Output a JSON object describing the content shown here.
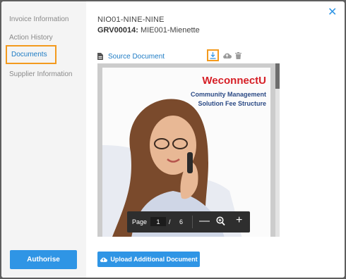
{
  "sidebar": {
    "items": [
      {
        "label": "Invoice Information"
      },
      {
        "label": "Action History"
      },
      {
        "label": "Documents"
      },
      {
        "label": "Supplier Information"
      }
    ],
    "authorise_label": "Authorise"
  },
  "header": {
    "invoice_number": "NIO01-NINE-NINE",
    "grv_code": "GRV00014:",
    "grv_name": " MIE001-Mienette"
  },
  "document": {
    "source_link": "Source Document",
    "actions": {
      "download": "download-icon",
      "upload": "cloud-upload-icon",
      "delete": "trash-icon"
    }
  },
  "preview": {
    "brand": "WeconnectU",
    "heading_line1": "Community Management",
    "heading_line2": "Solution Fee Structure",
    "pager": {
      "label": "Page",
      "current": "1",
      "separator": "/",
      "total": "6"
    }
  },
  "upload_label": "Upload Additional Document",
  "colors": {
    "accent": "#2f95e5",
    "highlight": "#f39a1e",
    "brand_red": "#d61f26",
    "heading_navy": "#2b4a85"
  }
}
